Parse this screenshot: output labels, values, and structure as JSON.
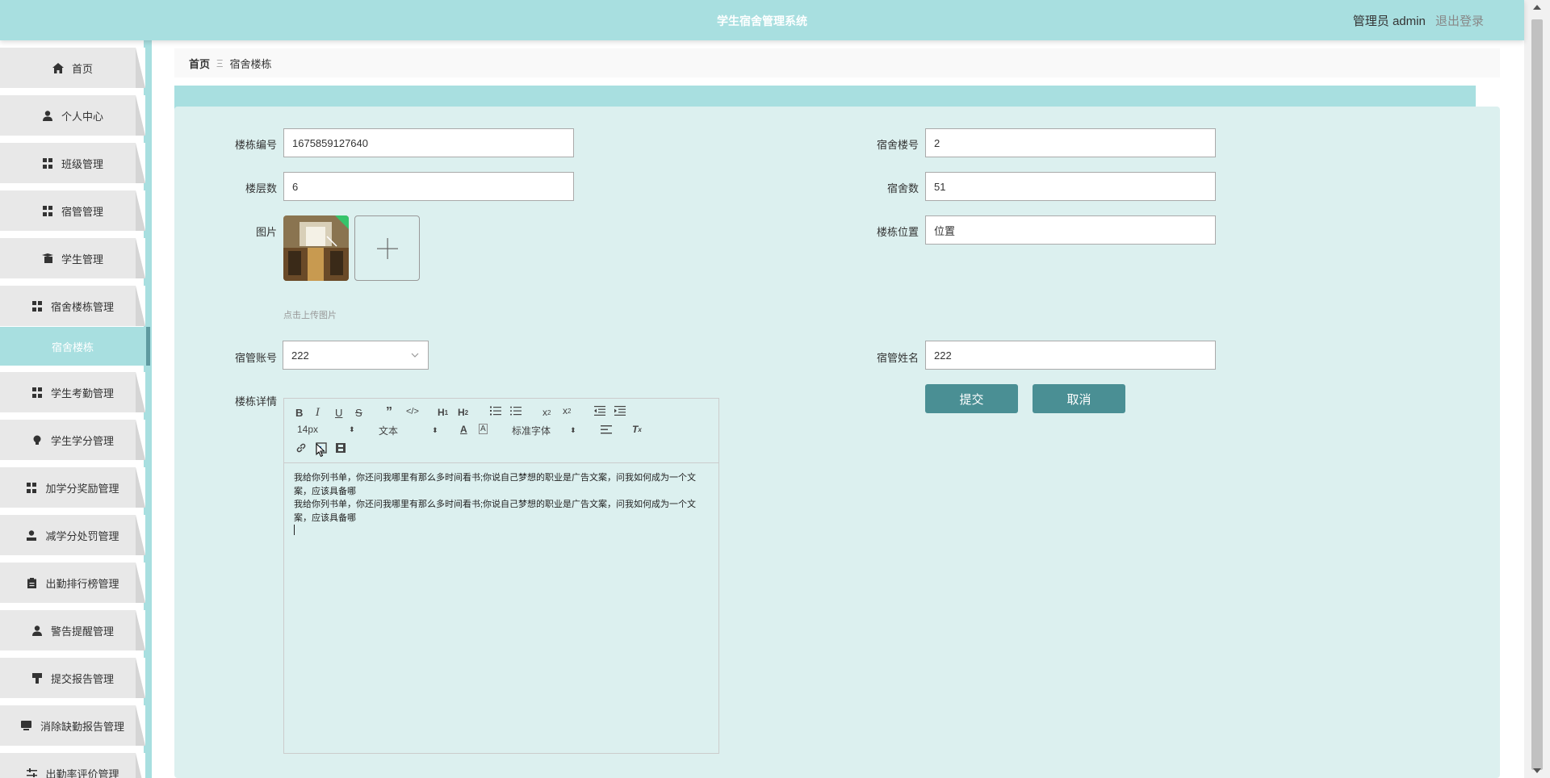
{
  "header": {
    "title": "学生宿舍管理系统",
    "user_label": "管理员 admin",
    "logout": "退出登录"
  },
  "sidebar": {
    "items": [
      {
        "label": "首页",
        "icon": "home-icon"
      },
      {
        "label": "个人中心",
        "icon": "user-icon"
      },
      {
        "label": "班级管理",
        "icon": "grid-icon"
      },
      {
        "label": "宿管管理",
        "icon": "grid-icon"
      },
      {
        "label": "学生管理",
        "icon": "student-icon"
      },
      {
        "label": "宿舍楼栋管理",
        "icon": "grid-icon"
      },
      {
        "label": "学生考勤管理",
        "icon": "grid-icon"
      },
      {
        "label": "学生学分管理",
        "icon": "bulb-icon"
      },
      {
        "label": "加学分奖励管理",
        "icon": "grid-icon"
      },
      {
        "label": "减学分处罚管理",
        "icon": "user-icon"
      },
      {
        "label": "出勤排行榜管理",
        "icon": "clipboard-icon"
      },
      {
        "label": "警告提醒管理",
        "icon": "user-icon"
      },
      {
        "label": "提交报告管理",
        "icon": "podium-icon"
      },
      {
        "label": "消除缺勤报告管理",
        "icon": "monitor-icon"
      },
      {
        "label": "出勤率评价管理",
        "icon": "sliders-icon"
      }
    ],
    "active_sub": "宿舍楼栋"
  },
  "breadcrumb": {
    "home": "首页",
    "current": "宿舍楼栋"
  },
  "form": {
    "building_no_label": "楼栋编号",
    "building_no": "1675859127640",
    "dorm_building_label": "宿舍楼号",
    "dorm_building": "2",
    "floors_label": "楼层数",
    "floors": "6",
    "dorm_count_label": "宿舍数",
    "dorm_count": "51",
    "image_label": "图片",
    "upload_hint": "点击上传图片",
    "location_label": "楼栋位置",
    "location": "位置",
    "manager_account_label": "宿管账号",
    "manager_account": "222",
    "manager_name_label": "宿管姓名",
    "manager_name": "222",
    "details_label": "楼栋详情",
    "submit": "提交",
    "cancel": "取消"
  },
  "editor": {
    "font_size": "14px",
    "text_type": "文本",
    "font_family": "标准字体",
    "content": [
      "我给你列书单，你还问我哪里有那么多时间看书;你说自己梦想的职业是广告文案，问我如何成为一个文案，应该具备哪",
      "我给你列书单，你还问我哪里有那么多时间看书;你说自己梦想的职业是广告文案，问我如何成为一个文案，应该具备哪"
    ]
  },
  "colors": {
    "header_bg": "#a8dfe0",
    "panel_bg": "#dcf0ef",
    "button_bg": "#4a8f94"
  }
}
